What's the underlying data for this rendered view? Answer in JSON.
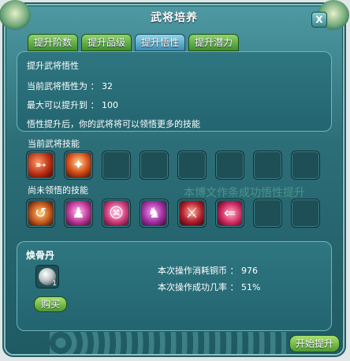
{
  "window": {
    "title": "武将培养",
    "close_label": "X"
  },
  "tabs": [
    {
      "label": "提升阶数",
      "active": false
    },
    {
      "label": "提升品级",
      "active": false
    },
    {
      "label": "提升悟性",
      "active": true
    },
    {
      "label": "提升潜力",
      "active": false
    }
  ],
  "info": {
    "heading": "提升武将悟性",
    "current_line": "当前武将悟性为 ： 32",
    "max_line": "最大可以提升到 ： 100",
    "desc": "悟性提升后，你的武将将可以领悟更多的技能"
  },
  "skills_current": {
    "label": "当前武将技能",
    "icons": [
      "fire-slash-skill-icon",
      "flame-burst-skill-icon"
    ]
  },
  "skills_unlearned": {
    "label": "尚未领悟的技能",
    "icons": [
      "spin-strike-skill-icon",
      "hooded-figure-skill-icon",
      "mask-face-skill-icon",
      "dancer-skill-icon",
      "blade-slash-skill-icon",
      "thrust-skill-icon"
    ]
  },
  "watermark": "本博文作条成功悟性提升",
  "item": {
    "name": "焕骨丹",
    "quantity": "1",
    "buy_label": "购买"
  },
  "cost": {
    "copper_line": "本次操作消耗铜币 ： 976",
    "rate_line": "本次操作成功几率 ： 51%"
  },
  "actions": {
    "start_label": "开始提升"
  },
  "colors": {
    "panel": "#2e7680",
    "tab_green": "#5fae3c",
    "tab_active": "#4d9ec2"
  }
}
